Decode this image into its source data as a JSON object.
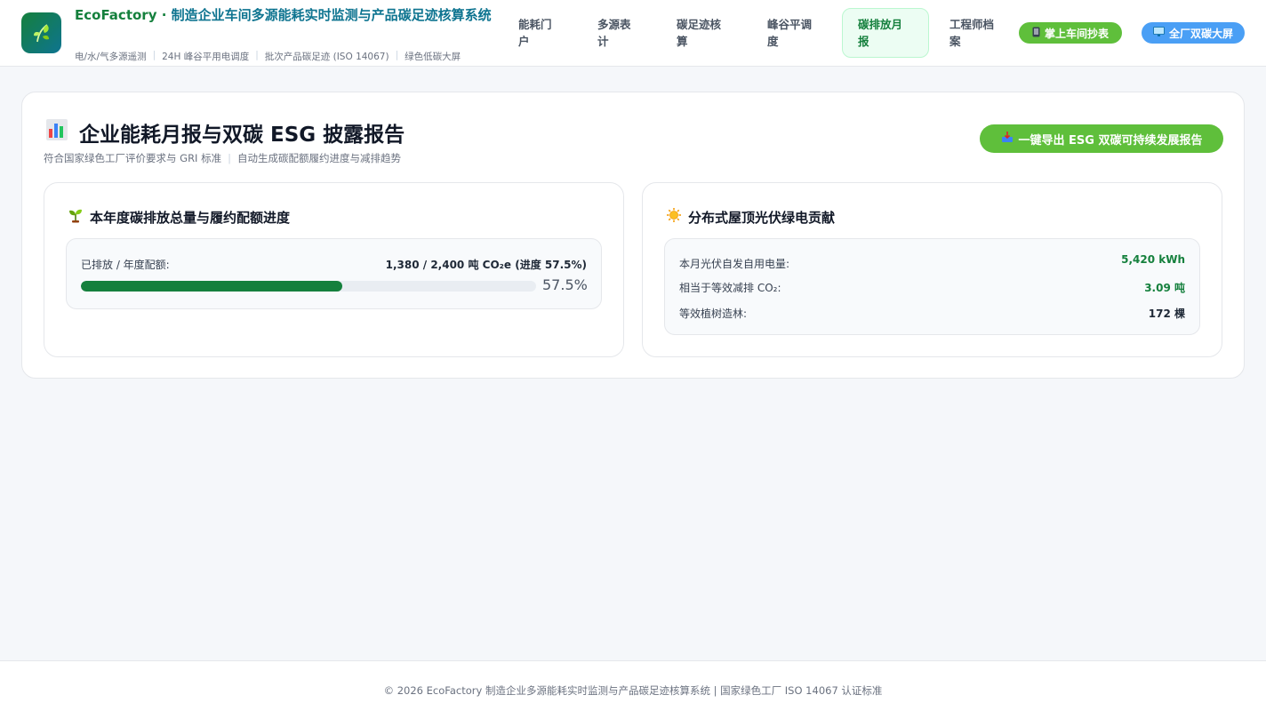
{
  "header": {
    "brand_name": "EcoFactory · ",
    "brand_desc": "制造企业车间多源能耗实时监测与产品碳足迹核算系统",
    "tags": [
      "电/水/气多源遥测",
      "24H 峰谷平用电调度",
      "批次产品碳足迹 (ISO 14067)",
      "绿色低碳大屏"
    ],
    "nav": [
      {
        "label": "能耗门户",
        "active": false
      },
      {
        "label": "多源表计",
        "active": false
      },
      {
        "label": "碳足迹核算",
        "active": false
      },
      {
        "label": "峰谷平调度",
        "active": false
      },
      {
        "label": "碳排放月报",
        "active": true
      },
      {
        "label": "工程师档案",
        "active": false
      }
    ],
    "btn_mobile": "掌上车间抄表",
    "btn_screen": "全厂双碳大屏",
    "icons": {
      "logo": "leaf-icon",
      "mobile": "phone-icon",
      "screen": "monitor-icon"
    }
  },
  "main": {
    "title": "企业能耗月报与双碳 ESG 披露报告",
    "subtitle_parts": [
      "符合国家绿色工厂评价要求与 GRI 标准",
      "自动生成碳配额履约进度与减排趋势"
    ],
    "export_label": "一键导出 ESG 双碳可持续发展报告",
    "left_panel": {
      "title": "本年度碳排放总量与履约配额进度",
      "label": "已排放 / 年度配额:",
      "value": "1,380 / 2,400 吨 CO₂e (进度 57.5%)",
      "progress": 0.575,
      "progress_text": "57.5%"
    },
    "right_panel": {
      "title": "分布式屋顶光伏绿电贡献",
      "rows": [
        {
          "label": "本月光伏自发自用电量:",
          "value": "5,420 kWh",
          "tone": "green"
        },
        {
          "label": "相当于等效减排 CO₂:",
          "value": "3.09 吨",
          "tone": "green"
        },
        {
          "label": "等效植树造林:",
          "value": "172 棵",
          "tone": "dark"
        }
      ]
    }
  },
  "footer": {
    "text": "© 2026 EcoFactory 制造企业多源能耗实时监测与产品碳足迹核算系统 | 国家绿色工厂 ISO 14067 认证标准"
  },
  "colors": {
    "brand_green": "#15803d",
    "brand_teal": "#0e7490",
    "pill_green": "#5fbf3b",
    "pill_blue": "#4a9ff5"
  }
}
